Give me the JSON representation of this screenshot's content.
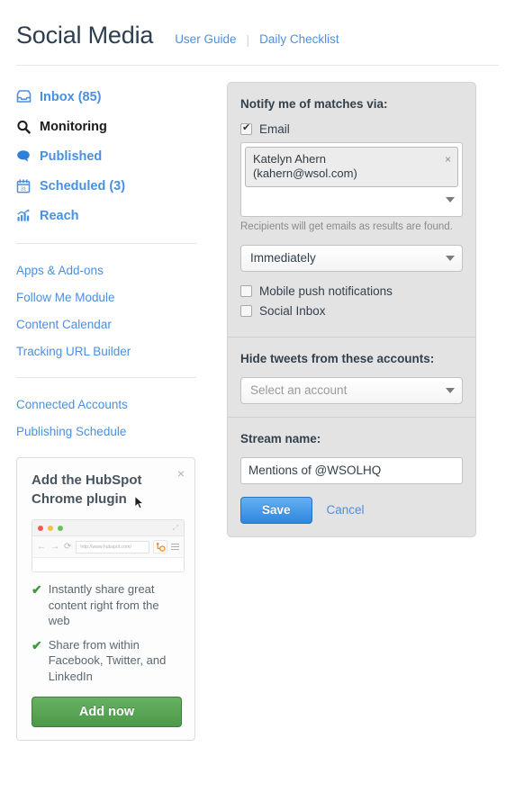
{
  "header": {
    "title": "Social Media",
    "links": [
      {
        "label": "User Guide"
      },
      {
        "label": "Daily Checklist"
      }
    ],
    "separator": "|"
  },
  "sidebar": {
    "nav": [
      {
        "label": "Inbox (85)",
        "icon": "inbox-icon",
        "active": false
      },
      {
        "label": "Monitoring",
        "icon": "search-icon",
        "active": true
      },
      {
        "label": "Published",
        "icon": "comment-icon",
        "active": false
      },
      {
        "label": "Scheduled (3)",
        "icon": "calendar-icon",
        "active": false,
        "day": "31"
      },
      {
        "label": "Reach",
        "icon": "chart-icon",
        "active": false
      }
    ],
    "tools": [
      {
        "label": "Apps & Add-ons"
      },
      {
        "label": "Follow Me Module"
      },
      {
        "label": "Content Calendar"
      },
      {
        "label": "Tracking URL Builder"
      }
    ],
    "settings": [
      {
        "label": "Connected Accounts"
      },
      {
        "label": "Publishing Schedule"
      }
    ],
    "promo": {
      "title": "Add the HubSpot Chrome plugin",
      "close_label": "×",
      "browser_url": "http://www.hubspot.com/",
      "bullets": [
        {
          "check": "✔",
          "text": "Instantly share great content right from the web"
        },
        {
          "check": "✔",
          "text": "Share from within Facebook, Twitter, and LinkedIn"
        }
      ],
      "button_label": "Add now"
    }
  },
  "panel": {
    "notify": {
      "title": "Notify me of matches via:",
      "email_checkbox": {
        "label": "Email",
        "checked": true
      },
      "recipients": [
        {
          "name": "Katelyn Ahern",
          "email": "(kahern@wsol.com)",
          "remove_label": "×"
        }
      ],
      "helper": "Recipients will get emails as results are found.",
      "frequency": {
        "value": "Immediately"
      },
      "options": [
        {
          "label": "Mobile push notifications",
          "checked": false
        },
        {
          "label": "Social Inbox",
          "checked": false
        }
      ]
    },
    "hide_tweets": {
      "title": "Hide tweets from these accounts:",
      "account_select": {
        "placeholder": "Select an account"
      }
    },
    "stream": {
      "title": "Stream name:",
      "name_value": "Mentions of @WSOLHQ",
      "save_label": "Save",
      "cancel_label": "Cancel"
    }
  },
  "colors": {
    "link_blue": "#4a90e2",
    "save_blue": "#2f86e0",
    "add_green": "#4b9a48",
    "panel_grey": "#e3e3e3",
    "title_dark": "#2d3e50"
  }
}
